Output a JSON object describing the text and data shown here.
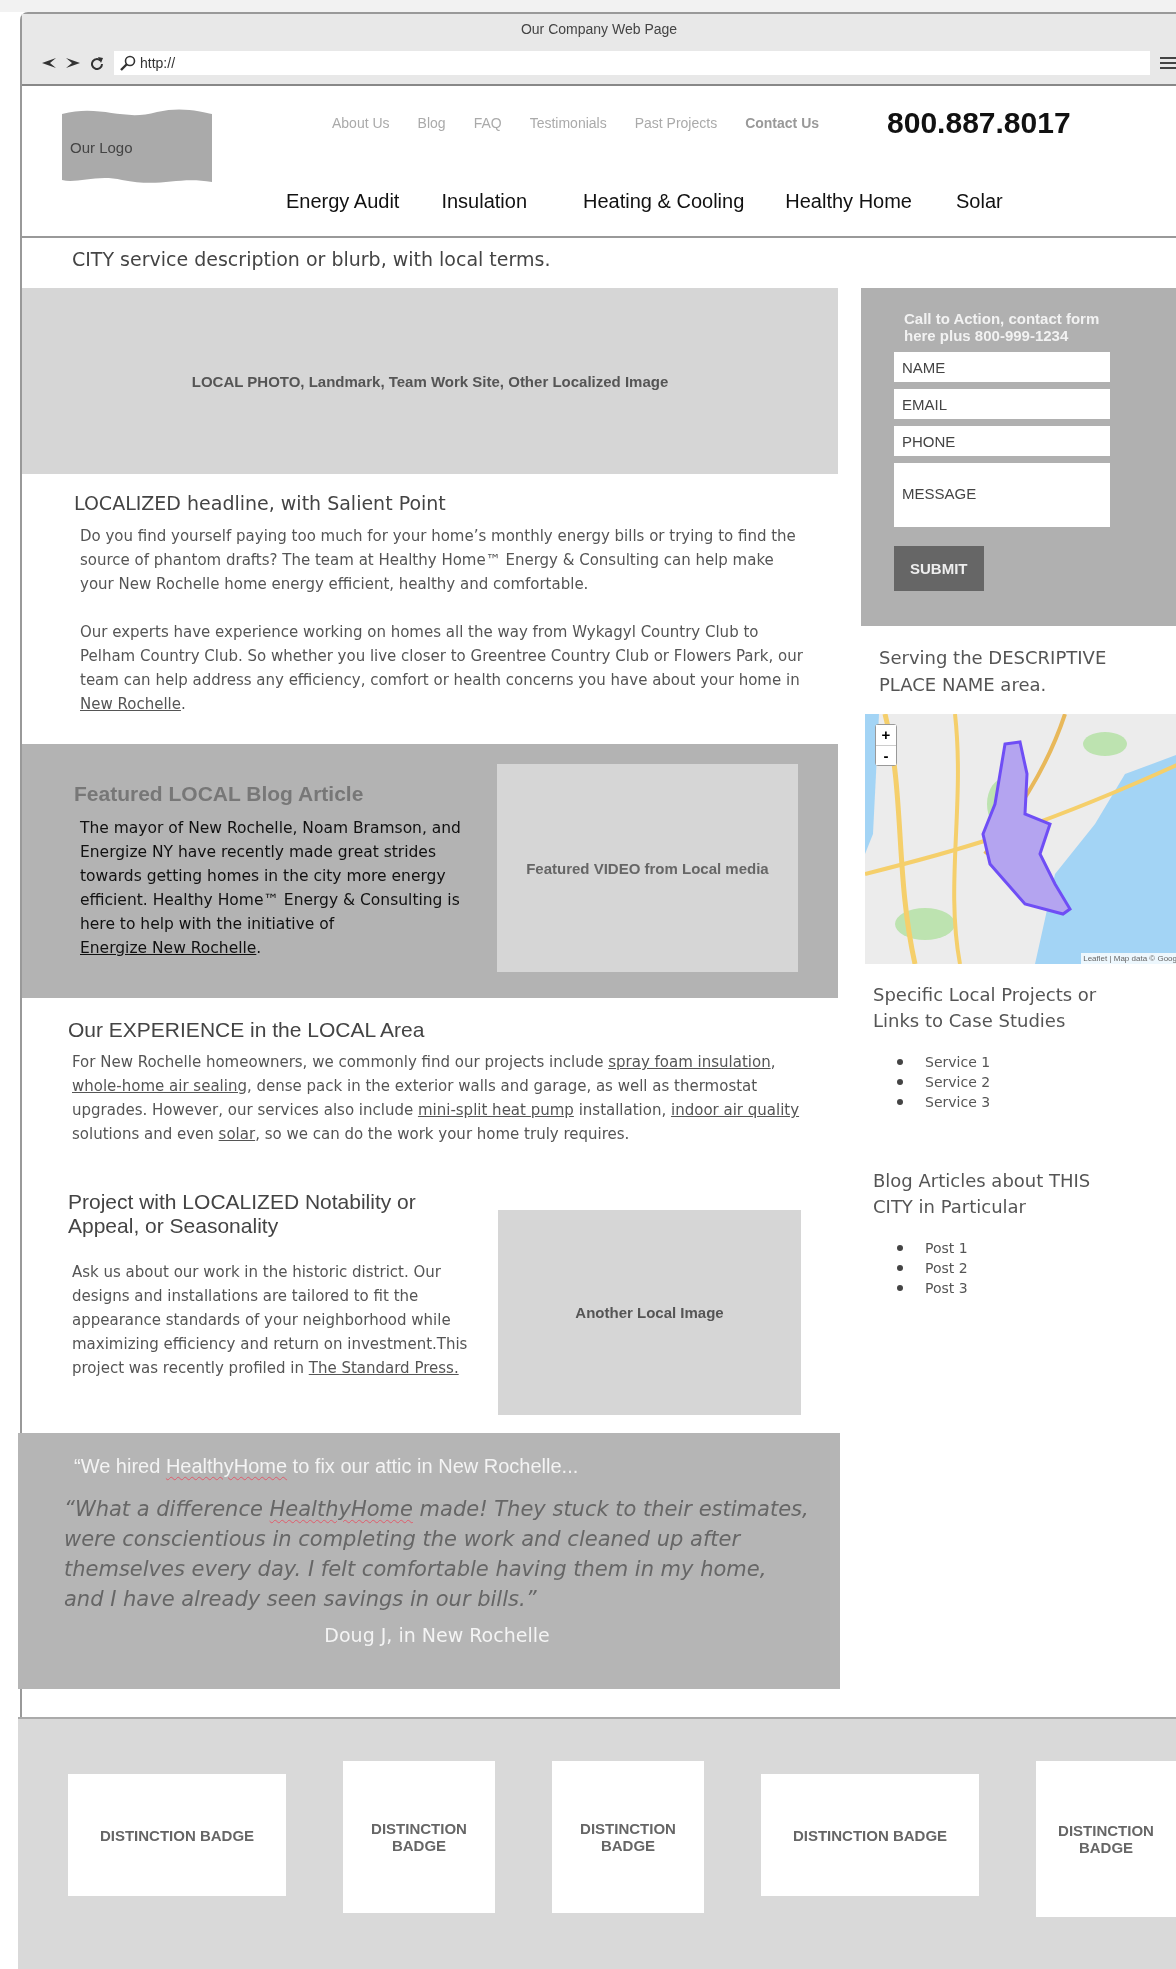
{
  "browser": {
    "title": "Our Company Web Page",
    "url": "http://"
  },
  "header": {
    "logo": "Our Logo",
    "top_links": [
      {
        "label": "About Us",
        "selected": false
      },
      {
        "label": "Blog",
        "selected": false
      },
      {
        "label": "FAQ",
        "selected": false
      },
      {
        "label": "Testimonials",
        "selected": false
      },
      {
        "label": "Past Projects",
        "selected": false
      },
      {
        "label": "Contact Us",
        "selected": true
      }
    ],
    "phone": "800.887.8017",
    "main_nav": [
      "Energy Audit",
      "Insulation",
      "Heating & Cooling",
      "Healthy Home",
      "Solar"
    ]
  },
  "blurb": "CITY service description or blurb, with local terms.",
  "hero_image": {
    "label": "LOCAL PHOTO, Landmark, Team Work Site, Other Localized Image"
  },
  "intro": {
    "headline": "LOCALIZED headline, with Salient Point",
    "paragraphs": [
      [
        {
          "kind": "text",
          "text": "Do you find yourself paying too much for your home’s monthly energy bills or trying to find the source of phantom drafts? The team at Healthy Home™ Energy & Consulting can help make your New Rochelle home energy efficient, healthy and comfortable."
        }
      ],
      [
        {
          "kind": "text",
          "text": "Our experts have experience working on homes all the way from Wykagyl Country Club to Pelham Country Club.  So whether you live closer to Greentree Country Club or Flowers Park, our team can help address any efficiency, comfort or health concerns you have about your home in "
        },
        {
          "kind": "link",
          "text": "New Rochelle"
        },
        {
          "kind": "text",
          "text": "."
        }
      ]
    ]
  },
  "featured": {
    "heading": "Featured LOCAL Blog Article",
    "paragraph": [
      {
        "kind": "text",
        "text": "The mayor of New Rochelle, Noam Bramson, and Energize NY have recently made great strides towards getting homes in the city more energy efficient. Healthy Home™ Energy & Consulting is here to help with the initiative of "
      },
      {
        "kind": "link",
        "text": "Energize New Rochelle"
      },
      {
        "kind": "text",
        "text": "."
      }
    ],
    "video": "Featured VIDEO from Local media"
  },
  "experience": {
    "heading": "Our EXPERIENCE in the LOCAL Area",
    "paragraph": [
      {
        "kind": "text",
        "text": "For New Rochelle homeowners, we commonly find our projects include "
      },
      {
        "kind": "link",
        "text": "spray foam insulation"
      },
      {
        "kind": "text",
        "text": ", "
      },
      {
        "kind": "link",
        "text": "whole-home air sealing"
      },
      {
        "kind": "text",
        "text": ", dense pack in the exterior walls and garage, as well as thermostat upgrades. However, our services also include "
      },
      {
        "kind": "link",
        "text": "mini-split heat pump"
      },
      {
        "kind": "text",
        "text": " installation, "
      },
      {
        "kind": "link",
        "text": "indoor air quality"
      },
      {
        "kind": "text",
        "text": " solutions and even "
      },
      {
        "kind": "link",
        "text": "solar"
      },
      {
        "kind": "text",
        "text": ", so we can do the work your home truly requires."
      }
    ]
  },
  "project": {
    "heading": "Project with LOCALIZED Notability or Appeal, or Seasonality",
    "paragraph": [
      {
        "kind": "text",
        "text": "Ask us about our work in the historic district. Our designs and installations are tailored to fit the appearance standards of your neighborhood while maximizing efficiency and return on investment.This project was recently profiled in "
      },
      {
        "kind": "link",
        "text": "The Standard Press."
      }
    ],
    "image": "Another Local Image"
  },
  "sidebar": {
    "cta": {
      "title": "Call to Action, contact form here plus 800-999-1234",
      "fields": [
        {
          "placeholder": "NAME",
          "kind": "line"
        },
        {
          "placeholder": "EMAIL",
          "kind": "line"
        },
        {
          "placeholder": "PHONE",
          "kind": "line"
        },
        {
          "placeholder": "MESSAGE",
          "kind": "area"
        }
      ],
      "submit": "SUBMIT"
    },
    "serving": "Serving the DESCRIPTIVE PLACE NAME area.",
    "map": {
      "zoom_in": "+",
      "zoom_out": "-",
      "attribution": "Leaflet | Map data © Goog"
    },
    "lists": [
      {
        "heading": "Specific Local Projects or Links to Case Studies",
        "items": [
          "Service 1",
          "Service 2",
          "Service 3"
        ]
      },
      {
        "heading": "Blog Articles about THIS CITY in Particular",
        "items": [
          "Post 1",
          "Post 2",
          "Post 3"
        ]
      }
    ]
  },
  "testimonial": {
    "headline": [
      {
        "kind": "text",
        "text": "“We hired "
      },
      {
        "kind": "misspelled",
        "text": "HealthyHome"
      },
      {
        "kind": "text",
        "text": " to fix our attic in New Rochelle..."
      }
    ],
    "quote": [
      {
        "kind": "text",
        "text": "“What a difference "
      },
      {
        "kind": "misspelled",
        "text": "HealthyHome"
      },
      {
        "kind": "text",
        "text": " made! They stuck to their estimates, were conscientious in completing the work and cleaned up after themselves every day. I felt comfortable having them in my home, and I have already seen savings in our bills.”"
      }
    ],
    "author": "Doug J, in New Rochelle"
  },
  "badges": [
    "DISTINCTION BADGE",
    "DISTINCTION BADGE",
    "DISTINCTION BADGE",
    "DISTINCTION BADGE",
    "DISTINCTION BADGE"
  ]
}
